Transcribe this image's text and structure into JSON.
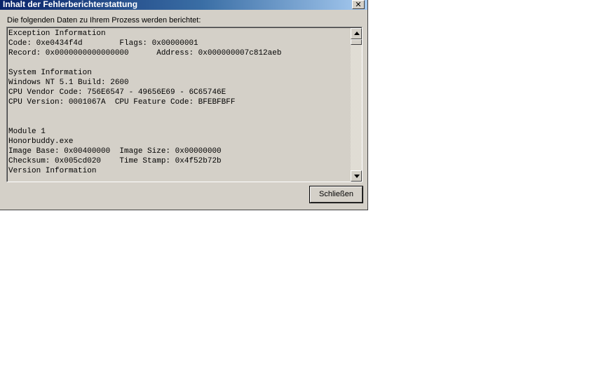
{
  "window": {
    "title": "Inhalt der Fehlerberichterstattung",
    "close_glyph": "✕"
  },
  "intro_label": "Die folgenden Daten zu Ihrem Prozess werden berichtet:",
  "report": {
    "lines": [
      "Exception Information",
      "Code: 0xe0434f4d        Flags: 0x00000001",
      "Record: 0x0000000000000000      Address: 0x000000007c812aeb",
      "",
      "System Information",
      "Windows NT 5.1 Build: 2600",
      "CPU Vendor Code: 756E6547 - 49656E69 - 6C65746E",
      "CPU Version: 0001067A  CPU Feature Code: BFEBFBFF",
      "",
      "",
      "Module 1",
      "Honorbuddy.exe",
      "Image Base: 0x00400000  Image Size: 0x00000000",
      "Checksum: 0x005cd020    Time Stamp: 0x4f52b72b",
      "Version Information"
    ]
  },
  "buttons": {
    "close_label": "Schließen"
  },
  "scrollbar": {
    "up_icon": "scroll-up-arrow-icon",
    "down_icon": "scroll-down-arrow-icon"
  },
  "colors": {
    "window_bg": "#d4d0c8",
    "titlebar_start": "#0a246a",
    "titlebar_end": "#a6caf0"
  }
}
